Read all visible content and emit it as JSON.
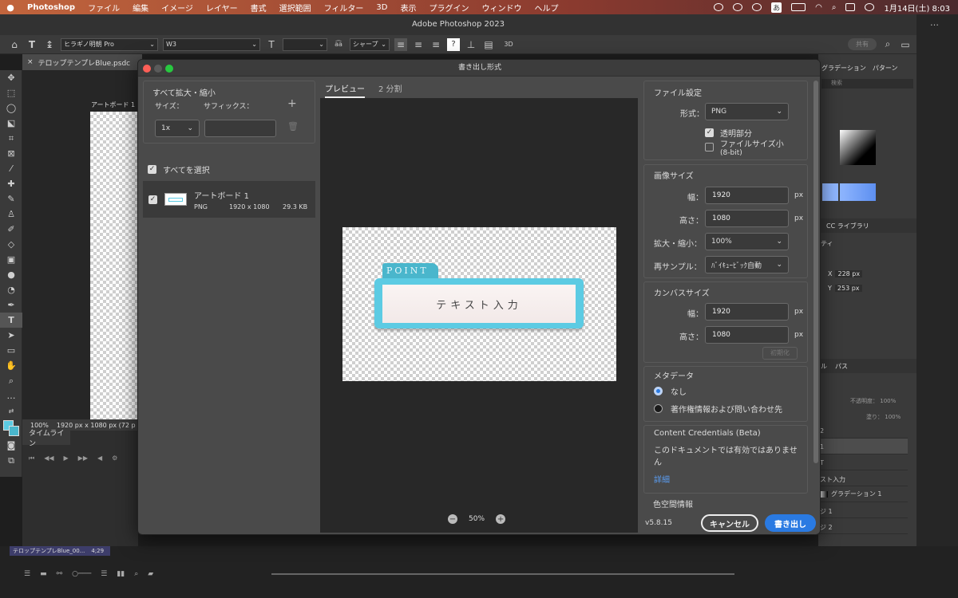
{
  "menubar": {
    "app": "Photoshop",
    "items": [
      "ファイル",
      "編集",
      "イメージ",
      "レイヤー",
      "書式",
      "選択範囲",
      "フィルター",
      "3D",
      "表示",
      "プラグイン",
      "ウィンドウ",
      "ヘルプ"
    ],
    "date_time": "1月14日(土) 8:03",
    "input_mode": "あ"
  },
  "window": {
    "title": "Adobe Photoshop 2023"
  },
  "options_bar": {
    "font_family": "ヒラギノ明朝 Pro",
    "font_style": "W3",
    "anti_alias": "シャープ",
    "share_label": "共有",
    "threed_label": "3D",
    "aa_label": "a͡a"
  },
  "document": {
    "tab_name": "テロップテンプレBlue.psdc",
    "artboard_label": "アートボード 1",
    "zoom": "100%",
    "dimensions": "1920 px x 1080 px (72 p",
    "timeline_tab": "タイムライン",
    "bottom_clip": "テロップテンプレBlue_00...",
    "bottom_clip_time": "4;29"
  },
  "right_panel": {
    "tab_gradient": "グラデーション",
    "tab_pattern": "パターン",
    "search_placeholder": "検索",
    "tab_cc": "CC ライブラリ",
    "properties_label": "ティ",
    "x_label": "X",
    "x_value": "228 px",
    "y_label": "Y",
    "y_value": "253 px",
    "tab_layers_suffix": "ル",
    "tab_paths": "パス",
    "opacity_label": "不透明度：",
    "opacity_value": "100%",
    "fill_label": "塗り：",
    "fill_value": "100%",
    "layers": [
      "2",
      "1",
      "T",
      "スト入力",
      "グラデーション 1",
      "ジ 1",
      "ジ 2"
    ]
  },
  "dialog": {
    "title": "書き出し形式",
    "scale_section": {
      "title": "すべて拡大・縮小",
      "size_label": "サイズ：",
      "suffix_label": "サフィックス：",
      "size_value": "1x",
      "suffix_value": ""
    },
    "select_all": "すべてを選択",
    "asset": {
      "name": "アートボード 1",
      "format": "PNG",
      "dims": "1920 x 1080",
      "filesize": "29.3 KB"
    },
    "tabs": [
      "プレビュー",
      "2 分割"
    ],
    "preview": {
      "badge": "POINT",
      "text": "テキスト入力",
      "zoom": "50%"
    },
    "file_settings": {
      "title": "ファイル設定",
      "format_label": "形式：",
      "format_value": "PNG",
      "transparency_label": "透明部分",
      "transparency_checked": true,
      "small_file_label": "ファイルサイズ小",
      "small_file_sub": "(8-bit)",
      "small_file_checked": false
    },
    "image_size": {
      "title": "画像サイズ",
      "width_label": "幅：",
      "width_value": "1920",
      "height_label": "高さ：",
      "height_value": "1080",
      "scale_label": "拡大・縮小：",
      "scale_value": "100%",
      "resample_label": "再サンプル：",
      "resample_value": "ﾊﾞｲｷｭｰﾋﾞｯｸ自動",
      "unit": "px"
    },
    "canvas_size": {
      "title": "カンバスサイズ",
      "width_label": "幅：",
      "width_value": "1920",
      "height_label": "高さ：",
      "height_value": "1080",
      "unit": "px",
      "reset_label": "初期化"
    },
    "metadata": {
      "title": "メタデータ",
      "option_none": "なし",
      "option_copyright": "著作権情報および問い合わせ先",
      "selected": "なし"
    },
    "content_credentials": {
      "title": "Content Credentials (Beta)",
      "message": "このドキュメントでは有効ではありません",
      "link": "詳細"
    },
    "color_space_title": "色空間情報",
    "version": "v5.8.15",
    "cancel_label": "キャンセル",
    "export_label": "書き出し"
  },
  "colors": {
    "accent_blue": "#2a7ae2",
    "badge_teal": "#4ab6cc",
    "frame_blue": "#5ccbe3"
  }
}
